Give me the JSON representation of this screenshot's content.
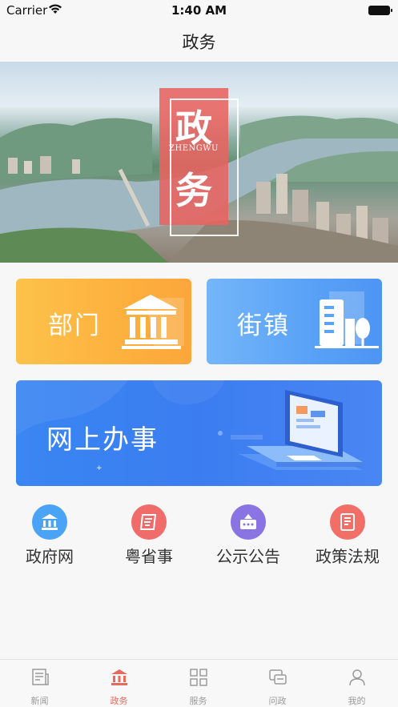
{
  "status_bar": {
    "carrier": "Carrier",
    "time": "1:40 AM"
  },
  "nav": {
    "title": "政务"
  },
  "banner": {
    "char_1": "政",
    "subtitle": "ZHENGWU",
    "char_2": "务"
  },
  "cards": {
    "department": {
      "label": "部门",
      "icon": "government-building-icon"
    },
    "street": {
      "label": "街镇",
      "icon": "office-building-icon"
    },
    "online": {
      "label": "网上办事",
      "icon": "laptop-icon"
    }
  },
  "quick_links": [
    {
      "label": "政府网",
      "icon": "government-icon",
      "color": "#4aa3f5"
    },
    {
      "label": "粤省事",
      "icon": "document-icon",
      "color": "#f06c6a"
    },
    {
      "label": "公示公告",
      "icon": "notice-board-icon",
      "color": "#8a73e3"
    },
    {
      "label": "政策法规",
      "icon": "book-icon",
      "color": "#f16f66"
    }
  ],
  "tabs": [
    {
      "label": "新闻",
      "icon": "news-icon",
      "active": false
    },
    {
      "label": "政务",
      "icon": "government-icon",
      "active": true
    },
    {
      "label": "服务",
      "icon": "grid-icon",
      "active": false
    },
    {
      "label": "问政",
      "icon": "chat-icon",
      "active": false
    },
    {
      "label": "我的",
      "icon": "user-icon",
      "active": false
    }
  ],
  "colors": {
    "accent": "#e76a5f",
    "tab_inactive": "#9a9a9a"
  }
}
